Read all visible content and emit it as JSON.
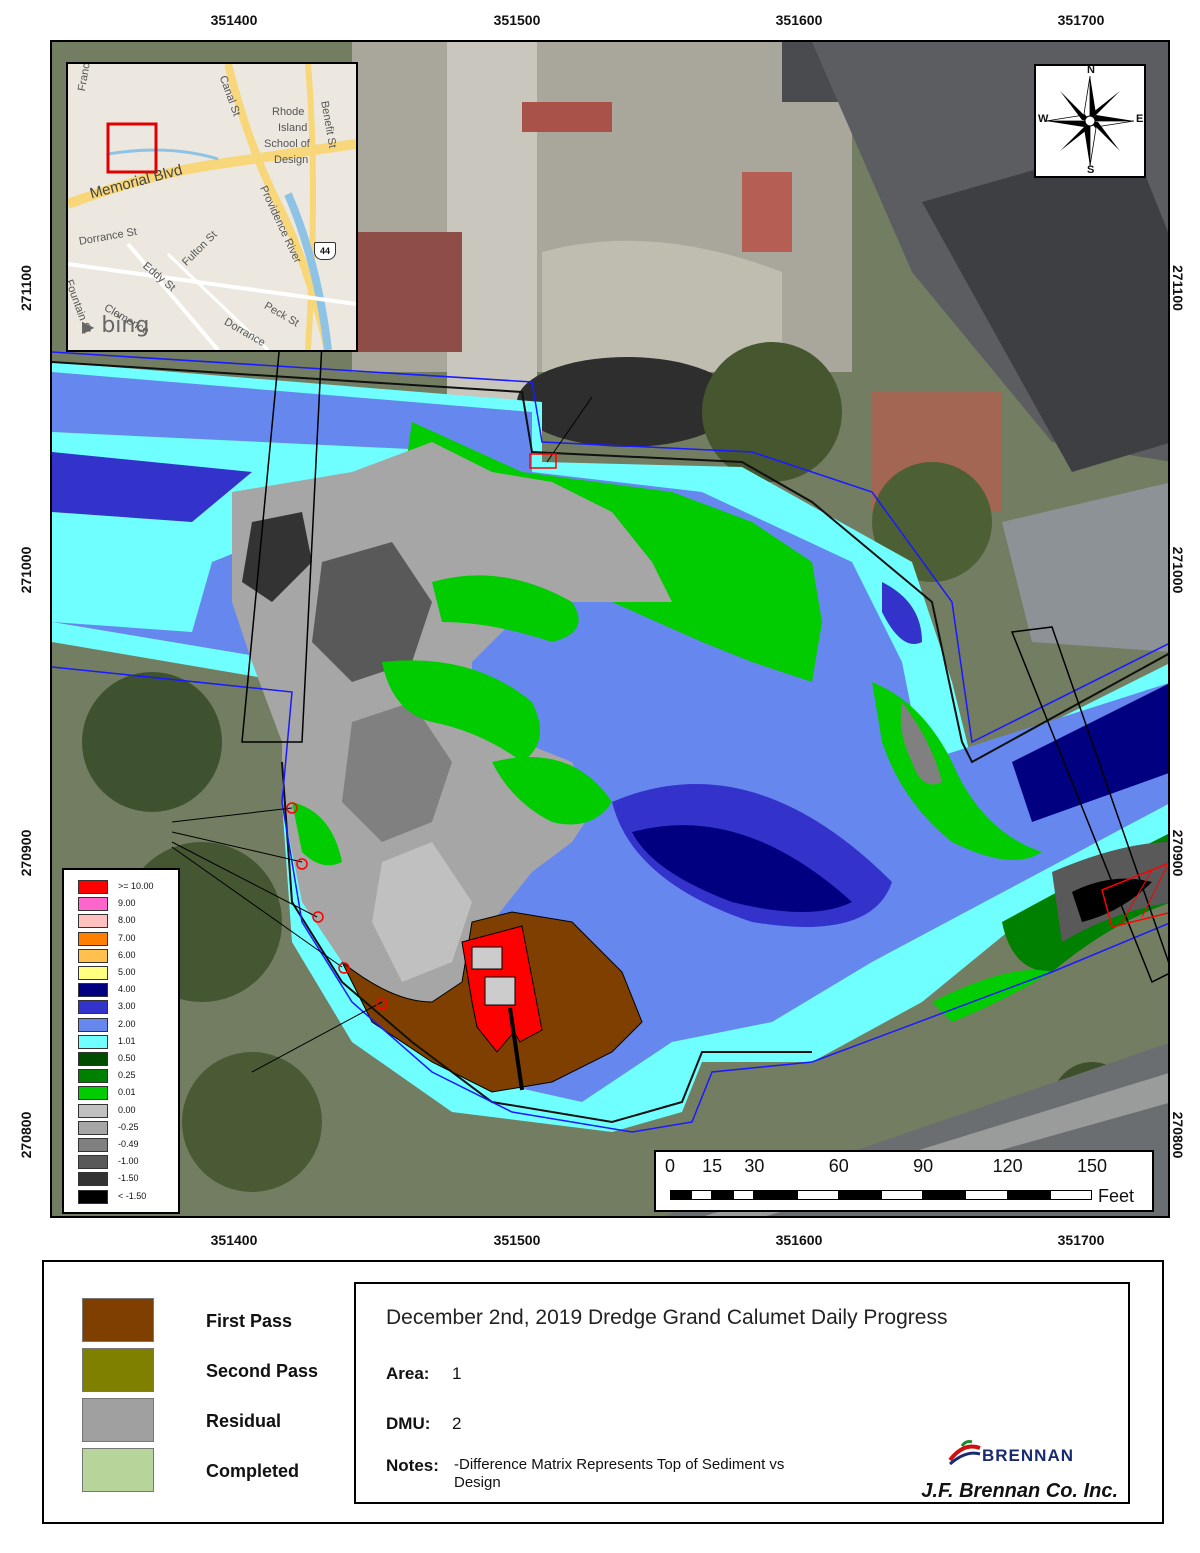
{
  "coordinates": {
    "easting": [
      "351400",
      "351500",
      "351600",
      "351700"
    ],
    "northing": [
      "271100",
      "271000",
      "270900",
      "270800"
    ]
  },
  "inset_map": {
    "streets": [
      "Francis St",
      "Canal St",
      "Rhode",
      "Island",
      "School of",
      "Design",
      "Benefit St",
      "Memorial Blvd",
      "Providence River",
      "Dorrance St",
      "Eddy St",
      "Fulton St",
      "Clemence",
      "Fountain St",
      "Peck St",
      "Dorrance"
    ],
    "highway_shield": "44",
    "logo": "bing"
  },
  "north_arrow": {
    "n": "N",
    "s": "S",
    "e": "E",
    "w": "W"
  },
  "depth_legend": {
    "items": [
      {
        "label": ">= 10.00",
        "color": "#ff0000"
      },
      {
        "label": "9.00",
        "color": "#ff66cc"
      },
      {
        "label": "8.00",
        "color": "#ffc0c0"
      },
      {
        "label": "7.00",
        "color": "#ff8000"
      },
      {
        "label": "6.00",
        "color": "#ffc04d"
      },
      {
        "label": "5.00",
        "color": "#ffff80"
      },
      {
        "label": "4.00",
        "color": "#000080"
      },
      {
        "label": "3.00",
        "color": "#3333cc"
      },
      {
        "label": "2.00",
        "color": "#6688ee"
      },
      {
        "label": "1.01",
        "color": "#70ffff"
      },
      {
        "label": "0.50",
        "color": "#004d00"
      },
      {
        "label": "0.25",
        "color": "#008000"
      },
      {
        "label": "0.01",
        "color": "#00cc00"
      },
      {
        "label": "0.00",
        "color": "#c0c0c0"
      },
      {
        "label": "-0.25",
        "color": "#a6a6a6"
      },
      {
        "label": "-0.49",
        "color": "#808080"
      },
      {
        "label": "-1.00",
        "color": "#595959"
      },
      {
        "label": "-1.50",
        "color": "#333333"
      },
      {
        "label": "< -1.50",
        "color": "#000000"
      }
    ]
  },
  "scale_bar": {
    "ticks": [
      "0",
      "15",
      "30",
      "60",
      "90",
      "120",
      "150"
    ],
    "tick_values": [
      0,
      15,
      30,
      60,
      90,
      120,
      150
    ],
    "unit": "Feet"
  },
  "pass_legend": [
    {
      "label": "First Pass",
      "color": "#7f3f00"
    },
    {
      "label": "Second Pass",
      "color": "#808000"
    },
    {
      "label": "Residual",
      "color": "#a0a0a0"
    },
    {
      "label": "Completed",
      "color": "#b7d49a"
    }
  ],
  "title_block": {
    "title": "December 2nd, 2019 Dredge Grand Calumet Daily Progress",
    "area_label": "Area:",
    "area_value": "1",
    "dmu_label": "DMU:",
    "dmu_value": "2",
    "notes_label": "Notes:",
    "notes_value": "-Difference Matrix Represents Top of Sediment vs Design",
    "logo_text": "BRENNAN",
    "company": "J.F. Brennan Co. Inc."
  }
}
